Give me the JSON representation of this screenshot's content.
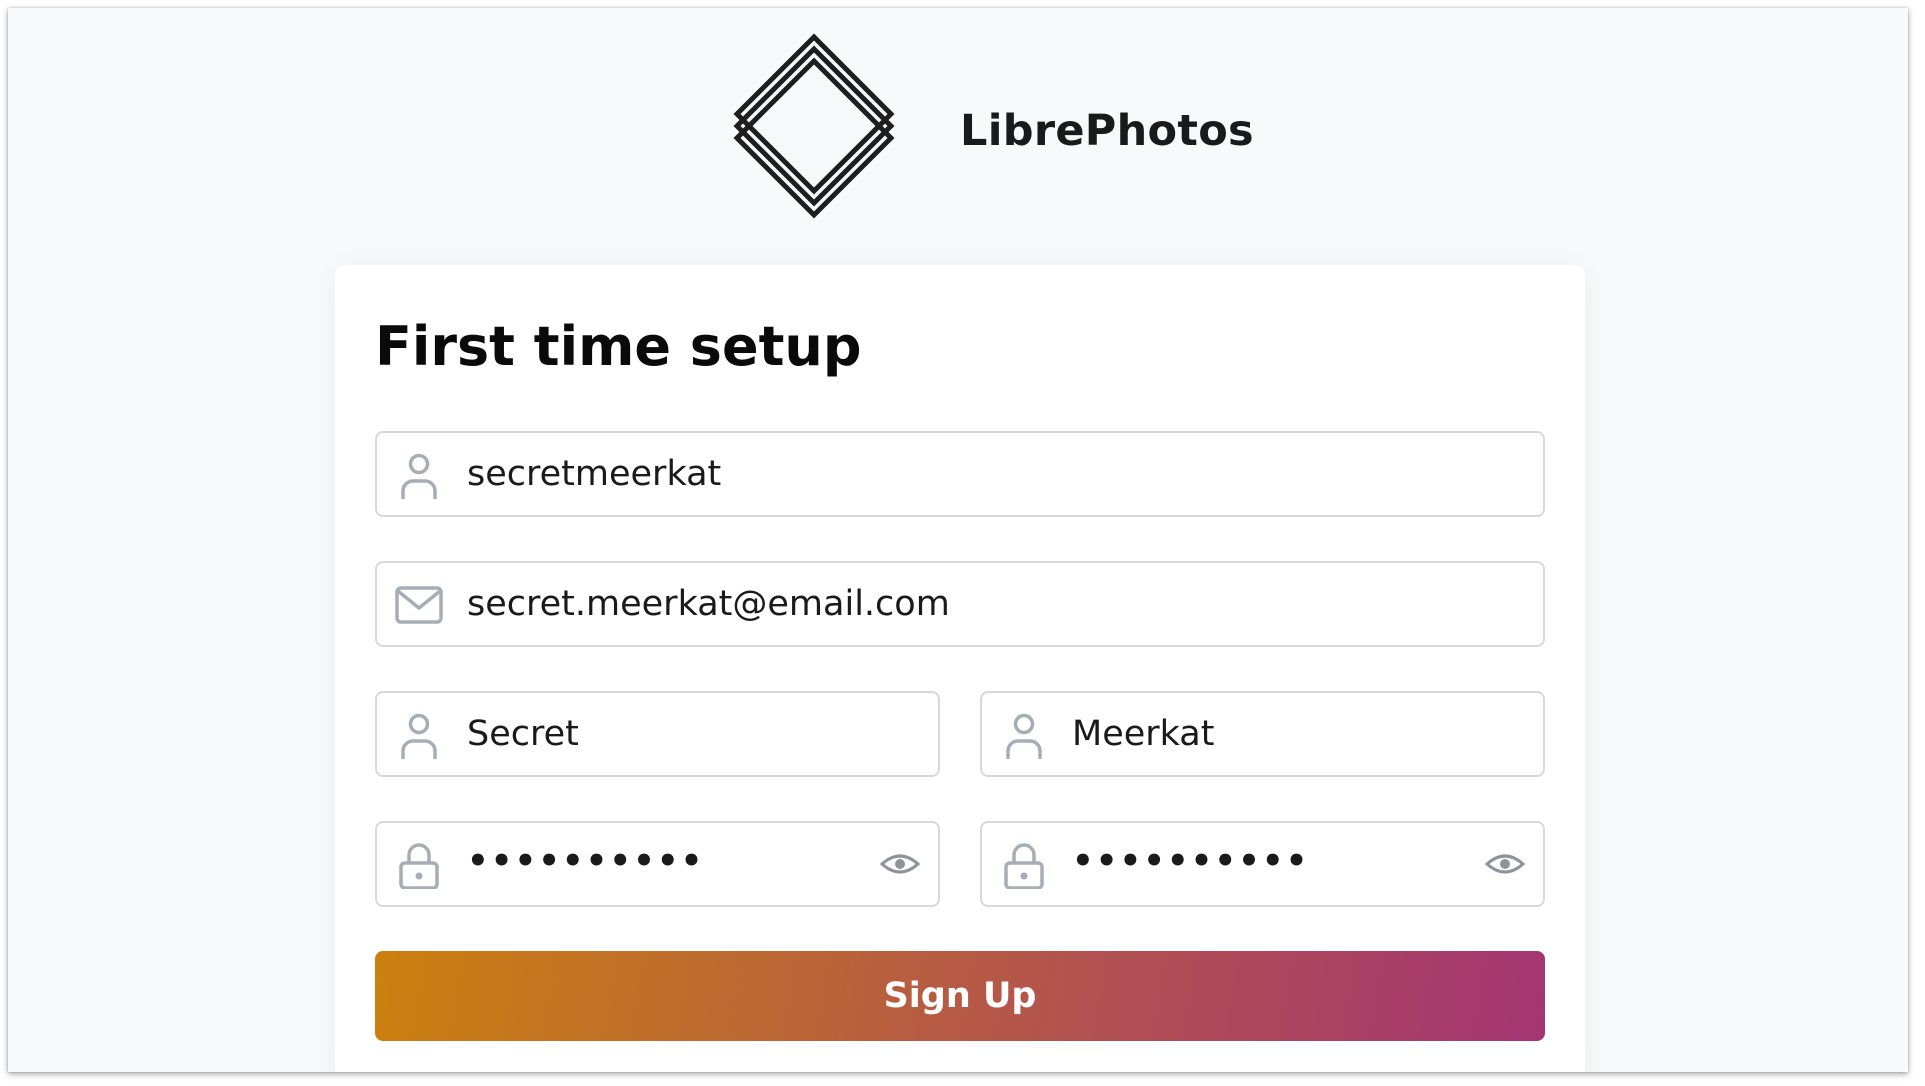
{
  "header": {
    "brand_name": "LibrePhotos",
    "logo_icon": "librephotos-diamond-logo-icon"
  },
  "setup_form": {
    "title": "First time setup",
    "username": {
      "value": "secretmeerkat",
      "icon": "user-icon"
    },
    "email": {
      "value": "secret.meerkat@email.com",
      "icon": "envelope-icon"
    },
    "first_name": {
      "value": "Secret",
      "icon": "user-icon"
    },
    "last_name": {
      "value": "Meerkat",
      "icon": "user-icon"
    },
    "password": {
      "value": "••••••••••",
      "icon": "lock-icon",
      "toggle_icon": "eye-icon"
    },
    "password_confirm": {
      "value": "••••••••••",
      "icon": "lock-icon",
      "toggle_icon": "eye-icon"
    },
    "submit_label": "Sign Up"
  },
  "colors": {
    "background": "#f8f9fa",
    "card": "#ffffff",
    "field_border": "#d6d8dc",
    "icon": "#a7adb7",
    "button_gradient_start": "#cb800e",
    "button_gradient_end": "#a33573"
  }
}
